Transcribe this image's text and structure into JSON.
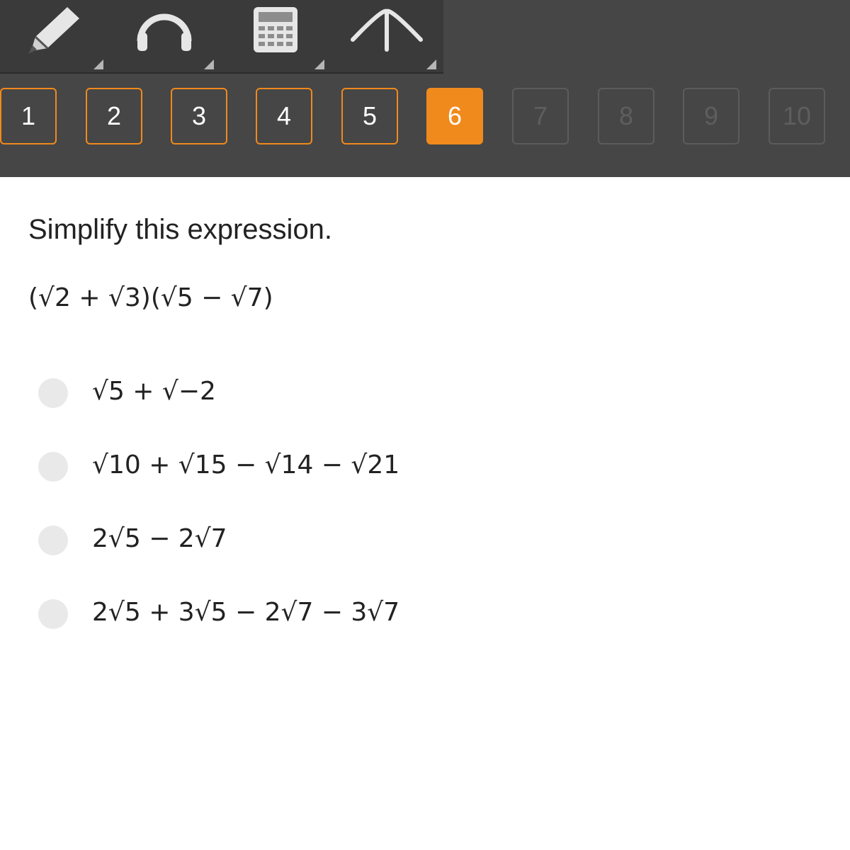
{
  "toolbar": {
    "tools": [
      {
        "icon": "pencil-icon"
      },
      {
        "icon": "headphones-icon"
      },
      {
        "icon": "calculator-icon"
      },
      {
        "icon": "reference-icon"
      }
    ]
  },
  "question_nav": {
    "items": [
      {
        "label": "1",
        "state": "answered"
      },
      {
        "label": "2",
        "state": "answered"
      },
      {
        "label": "3",
        "state": "answered"
      },
      {
        "label": "4",
        "state": "answered"
      },
      {
        "label": "5",
        "state": "answered"
      },
      {
        "label": "6",
        "state": "current"
      },
      {
        "label": "7",
        "state": "locked"
      },
      {
        "label": "8",
        "state": "locked"
      },
      {
        "label": "9",
        "state": "locked"
      },
      {
        "label": "10",
        "state": "locked"
      }
    ]
  },
  "question": {
    "prompt": "Simplify this expression.",
    "expression": "(√2 + √3)(√5 − √7)"
  },
  "options": [
    {
      "text": "√5 + √−2"
    },
    {
      "text": "√10 + √15 − √14 − √21"
    },
    {
      "text": "2√5 − 2√7"
    },
    {
      "text": "2√5 + 3√5 − 2√7 − 3√7"
    }
  ],
  "colors": {
    "accent": "#f18a1c",
    "topbar": "#464646",
    "toolbar": "#3a3a3a"
  }
}
